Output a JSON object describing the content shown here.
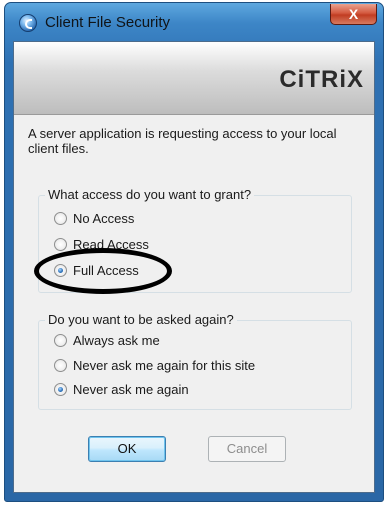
{
  "window": {
    "title": "Client File Security",
    "close_glyph": "X"
  },
  "banner": {
    "logo_text": "CiTRiX"
  },
  "intro_text": "A server application is requesting access to your local client files.",
  "access_group": {
    "legend": "What access do you want to grant?",
    "options": [
      {
        "label": "No Access",
        "checked": false
      },
      {
        "label": "Read Access",
        "checked": false
      },
      {
        "label": "Full Access",
        "checked": true
      }
    ]
  },
  "ask_group": {
    "legend": "Do you want to be asked again?",
    "options": [
      {
        "label": "Always ask me",
        "checked": false
      },
      {
        "label": "Never ask me again for this site",
        "checked": false
      },
      {
        "label": "Never ask me again",
        "checked": true
      }
    ]
  },
  "buttons": {
    "ok": "OK",
    "cancel": "Cancel"
  }
}
